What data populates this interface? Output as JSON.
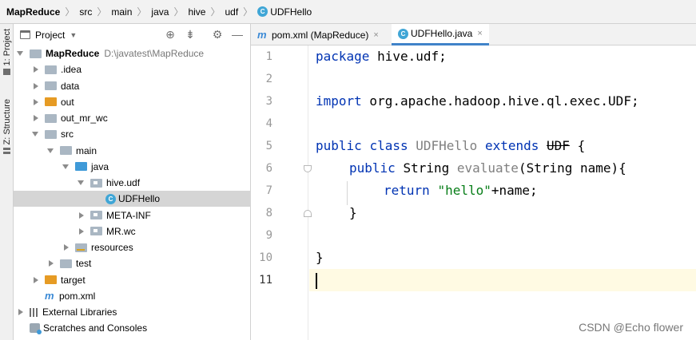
{
  "breadcrumb": {
    "items": [
      "MapReduce",
      "src",
      "main",
      "java",
      "hive",
      "udf",
      "UDFHello"
    ],
    "class_icon_letter": "C"
  },
  "side_tabs": {
    "project": "1: Project",
    "structure": "Z: Structure"
  },
  "project_panel": {
    "title": "Project",
    "tree": [
      {
        "label": "MapReduce",
        "path": "D:\\javatest\\MapReduce",
        "icon": "folder-grey",
        "arrow": "down",
        "level": 0,
        "bold": true
      },
      {
        "label": ".idea",
        "icon": "folder-grey",
        "arrow": "right",
        "level": 1
      },
      {
        "label": "data",
        "icon": "folder-grey",
        "arrow": "right",
        "level": 1
      },
      {
        "label": "out",
        "icon": "folder-orange",
        "arrow": "right",
        "level": 1
      },
      {
        "label": "out_mr_wc",
        "icon": "folder-grey",
        "arrow": "right",
        "level": 1
      },
      {
        "label": "src",
        "icon": "folder-grey",
        "arrow": "down",
        "level": 1
      },
      {
        "label": "main",
        "icon": "folder-grey",
        "arrow": "down",
        "level": 2
      },
      {
        "label": "java",
        "icon": "folder-blue",
        "arrow": "down",
        "level": 3
      },
      {
        "label": "hive.udf",
        "icon": "package",
        "arrow": "down",
        "level": 4
      },
      {
        "label": "UDFHello",
        "icon": "class",
        "arrow": "none",
        "level": 5,
        "selected": true
      },
      {
        "label": "META-INF",
        "icon": "package",
        "arrow": "right",
        "level": 4
      },
      {
        "label": "MR.wc",
        "icon": "package",
        "arrow": "right",
        "level": 4
      },
      {
        "label": "resources",
        "icon": "resources",
        "arrow": "right",
        "level": 3
      },
      {
        "label": "test",
        "icon": "folder-grey",
        "arrow": "right",
        "level": 2
      },
      {
        "label": "target",
        "icon": "folder-orange",
        "arrow": "right",
        "level": 1
      },
      {
        "label": "pom.xml",
        "icon": "maven",
        "arrow": "none",
        "level": 1
      },
      {
        "label": "External Libraries",
        "icon": "libraries",
        "arrow": "right",
        "level": 0
      },
      {
        "label": "Scratches and Consoles",
        "icon": "scratches",
        "arrow": "none",
        "level": 0
      }
    ]
  },
  "editor_tabs": [
    {
      "label": "pom.xml (MapReduce)",
      "icon_text": "m",
      "close": "×",
      "active": false
    },
    {
      "label": "UDFHello.java",
      "icon_text": "C",
      "close": "×",
      "active": true
    }
  ],
  "line_numbers": [
    "1",
    "2",
    "3",
    "4",
    "5",
    "6",
    "7",
    "8",
    "9",
    "10",
    "11"
  ],
  "code": {
    "l1_kw": "package",
    "l1_rest": " hive.udf;",
    "l3_kw": "import",
    "l3_rest": " org.apache.hadoop.hive.ql.exec.UDF;",
    "l5_kw1": "public",
    "l5_kw2": "class",
    "l5_cls": "UDFHello",
    "l5_kw3": "extends",
    "l5_udf": "UDF",
    "l5_brace": " {",
    "l6_kw": "public",
    "l6_type": "String",
    "l6_meth": "evaluate",
    "l6_rest": "(String name){",
    "l7_kw": "return",
    "l7_str": "\"hello\"",
    "l7_rest": "+name;",
    "l8": "}",
    "l10": "}"
  },
  "watermark": "CSDN @Echo flower"
}
